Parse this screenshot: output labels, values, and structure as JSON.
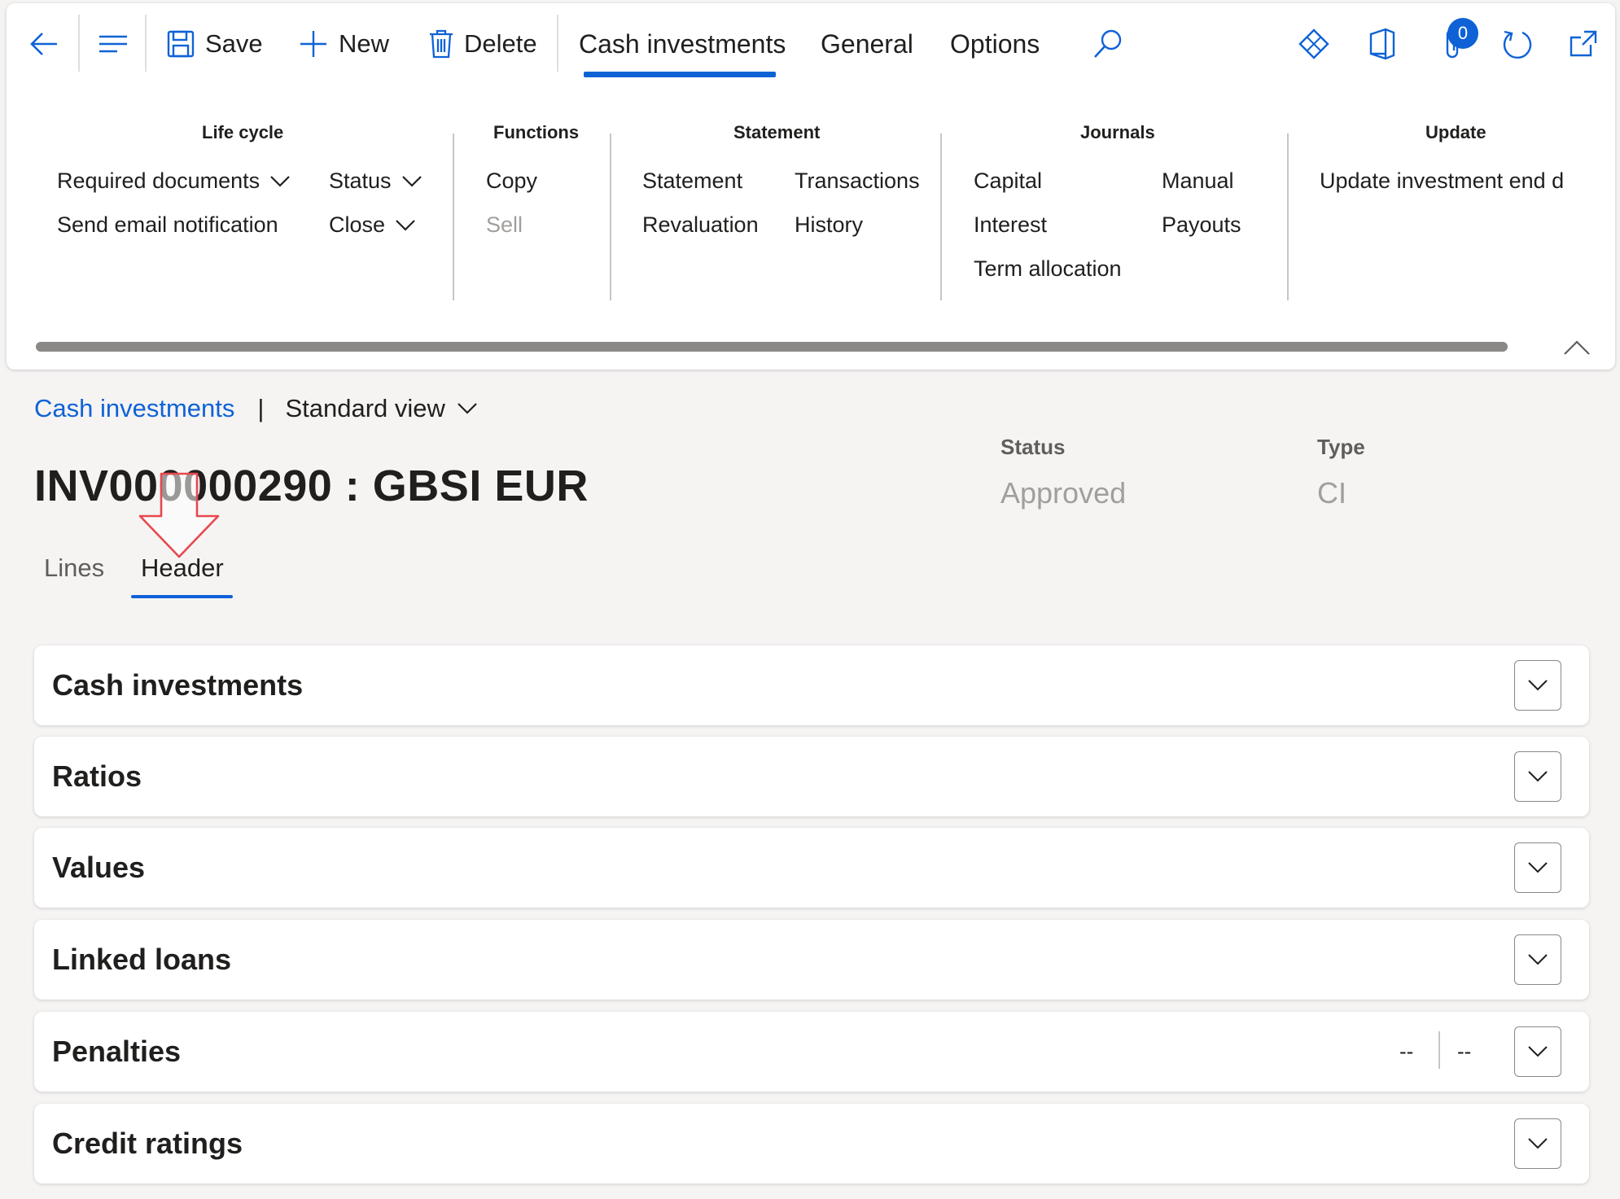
{
  "toolbar": {
    "save_label": "Save",
    "new_label": "New",
    "delete_label": "Delete",
    "tabs": [
      "Cash investments",
      "General",
      "Options"
    ],
    "notifications_count": "0"
  },
  "ribbon": {
    "life_cycle": {
      "title": "Life cycle",
      "required_documents": "Required documents",
      "send_email": "Send email notification",
      "status": "Status",
      "close": "Close"
    },
    "functions": {
      "title": "Functions",
      "copy": "Copy",
      "sell": "Sell"
    },
    "statement": {
      "title": "Statement",
      "statement": "Statement",
      "revaluation": "Revaluation",
      "transactions": "Transactions",
      "history": "History"
    },
    "journals": {
      "title": "Journals",
      "capital": "Capital",
      "interest": "Interest",
      "term_allocation": "Term allocation",
      "manual": "Manual",
      "payouts": "Payouts"
    },
    "update": {
      "title": "Update",
      "update_end": "Update investment end d"
    }
  },
  "breadcrumb": {
    "page": "Cash investments",
    "separator": "|",
    "view": "Standard view"
  },
  "record": {
    "title": "INV000000290 : GBSI EUR",
    "status_label": "Status",
    "status_value": "Approved",
    "type_label": "Type",
    "type_value": "CI"
  },
  "page_tabs": [
    "Lines",
    "Header"
  ],
  "fasttabs": [
    {
      "title": "Cash investments"
    },
    {
      "title": "Ratios"
    },
    {
      "title": "Values"
    },
    {
      "title": "Linked loans"
    },
    {
      "title": "Penalties",
      "summary": [
        "--",
        "--"
      ]
    },
    {
      "title": "Credit ratings"
    }
  ],
  "colors": {
    "accent": "#0f62d6",
    "callout": "#e8484f"
  }
}
